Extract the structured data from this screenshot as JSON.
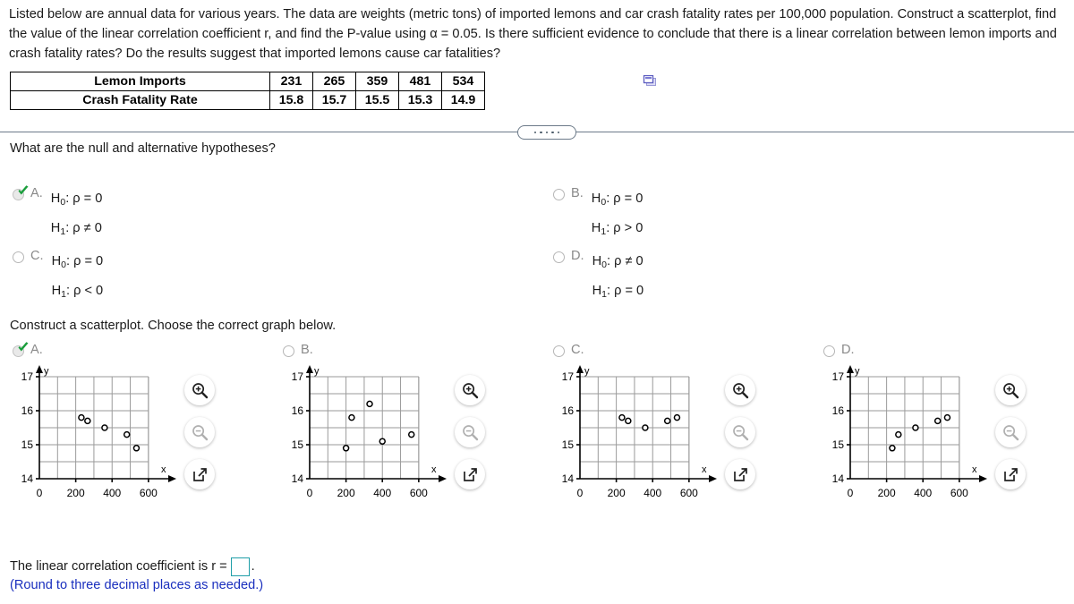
{
  "problem": {
    "paragraph": "Listed below are annual data for various years. The data are weights (metric tons) of imported lemons and car crash fatality rates per 100,000 population. Construct a scatterplot, find the value of the linear correlation coefficient r, and find the P-value using α = 0.05. Is there sufficient evidence to conclude that there is a linear correlation between lemon imports and crash fatality rates? Do the results suggest that imported lemons cause car fatalities?"
  },
  "data_table": {
    "rows": [
      {
        "label": "Lemon Imports",
        "values": [
          "231",
          "265",
          "359",
          "481",
          "534"
        ]
      },
      {
        "label": "Crash Fatality Rate",
        "values": [
          "15.8",
          "15.7",
          "15.5",
          "15.3",
          "14.9"
        ]
      }
    ],
    "copy_icon": "copy-to-spreadsheet-icon"
  },
  "divider": {
    "icon": "ellipsis-pill-handle",
    "dots": 5
  },
  "prompts": {
    "hypotheses": "What are the null and alternative hypotheses?",
    "scatterplot": "Construct a scatterplot. Choose the correct graph below."
  },
  "hypothesis_options": [
    {
      "letter": "A.",
      "selected": true,
      "null": "H₀: ρ = 0",
      "alt": "H₁: ρ ≠ 0",
      "null_sym": "H",
      "null_sub": "0",
      "null_rest": ": ρ = 0",
      "alt_sym": "H",
      "alt_sub": "1",
      "alt_rest": ": ρ ≠ 0"
    },
    {
      "letter": "B.",
      "selected": false,
      "null": "H₀: ρ = 0",
      "alt": "H₁: ρ > 0",
      "null_sym": "H",
      "null_sub": "0",
      "null_rest": ": ρ = 0",
      "alt_sym": "H",
      "alt_sub": "1",
      "alt_rest": ": ρ > 0"
    },
    {
      "letter": "C.",
      "selected": false,
      "null": "H₀: ρ = 0",
      "alt": "H₁: ρ < 0",
      "null_sym": "H",
      "null_sub": "0",
      "null_rest": ": ρ = 0",
      "alt_sym": "H",
      "alt_sub": "1",
      "alt_rest": ": ρ < 0"
    },
    {
      "letter": "D.",
      "selected": false,
      "null": "H₀: ρ ≠ 0",
      "alt": "H₁: ρ = 0",
      "null_sym": "H",
      "null_sub": "0",
      "null_rest": ": ρ ≠ 0",
      "alt_sym": "H",
      "alt_sub": "1",
      "alt_rest": ": ρ = 0"
    }
  ],
  "graph_options": [
    {
      "letter": "A.",
      "selected": true
    },
    {
      "letter": "B.",
      "selected": false
    },
    {
      "letter": "C.",
      "selected": false
    },
    {
      "letter": "D.",
      "selected": false
    }
  ],
  "graph_tools": [
    {
      "name": "zoom-in-icon",
      "state": "enabled"
    },
    {
      "name": "zoom-out-icon",
      "state": "disabled"
    },
    {
      "name": "open-in-new-window-icon",
      "state": "enabled"
    }
  ],
  "axis": {
    "x_label": "x",
    "y_label": "y",
    "x_ticks": [
      "0",
      "200",
      "400",
      "600"
    ],
    "y_ticks": [
      "14",
      "15",
      "16",
      "17"
    ],
    "xlim": [
      0,
      650
    ],
    "ylim": [
      14,
      17
    ]
  },
  "chart_data": [
    {
      "id": "A",
      "type": "scatter",
      "title": "A.",
      "xlabel": "x",
      "ylabel": "y",
      "xlim": [
        0,
        650
      ],
      "ylim": [
        14,
        17
      ],
      "x_ticks": [
        0,
        200,
        400,
        600
      ],
      "y_ticks": [
        14,
        15,
        16,
        17
      ],
      "grid": true,
      "x": [
        231,
        265,
        359,
        481,
        534
      ],
      "y": [
        15.8,
        15.7,
        15.5,
        15.3,
        14.9
      ]
    },
    {
      "id": "B",
      "type": "scatter",
      "title": "B.",
      "xlabel": "x",
      "ylabel": "y",
      "xlim": [
        0,
        650
      ],
      "ylim": [
        14,
        17
      ],
      "x_ticks": [
        0,
        200,
        400,
        600
      ],
      "y_ticks": [
        14,
        15,
        16,
        17
      ],
      "grid": true,
      "x": [
        200,
        231,
        330,
        400,
        560
      ],
      "y": [
        14.9,
        15.8,
        16.2,
        15.1,
        15.3
      ]
    },
    {
      "id": "C",
      "type": "scatter",
      "title": "C.",
      "xlabel": "x",
      "ylabel": "y",
      "xlim": [
        0,
        650
      ],
      "ylim": [
        14,
        17
      ],
      "x_ticks": [
        0,
        200,
        400,
        600
      ],
      "y_ticks": [
        14,
        15,
        16,
        17
      ],
      "grid": true,
      "x": [
        231,
        265,
        359,
        481,
        534
      ],
      "y": [
        15.8,
        15.7,
        15.5,
        15.7,
        15.8
      ]
    },
    {
      "id": "D",
      "type": "scatter",
      "title": "D.",
      "xlabel": "x",
      "ylabel": "y",
      "xlim": [
        0,
        650
      ],
      "ylim": [
        14,
        17
      ],
      "x_ticks": [
        0,
        200,
        400,
        600
      ],
      "y_ticks": [
        14,
        15,
        16,
        17
      ],
      "grid": true,
      "x": [
        231,
        265,
        359,
        481,
        534
      ],
      "y": [
        14.9,
        15.3,
        15.5,
        15.7,
        15.8
      ]
    }
  ],
  "footer": {
    "answer_prefix": "The linear correlation coefficient is r =",
    "answer_value": "",
    "period": ".",
    "rounding_note": "(Round to three decimal places as needed.)"
  }
}
